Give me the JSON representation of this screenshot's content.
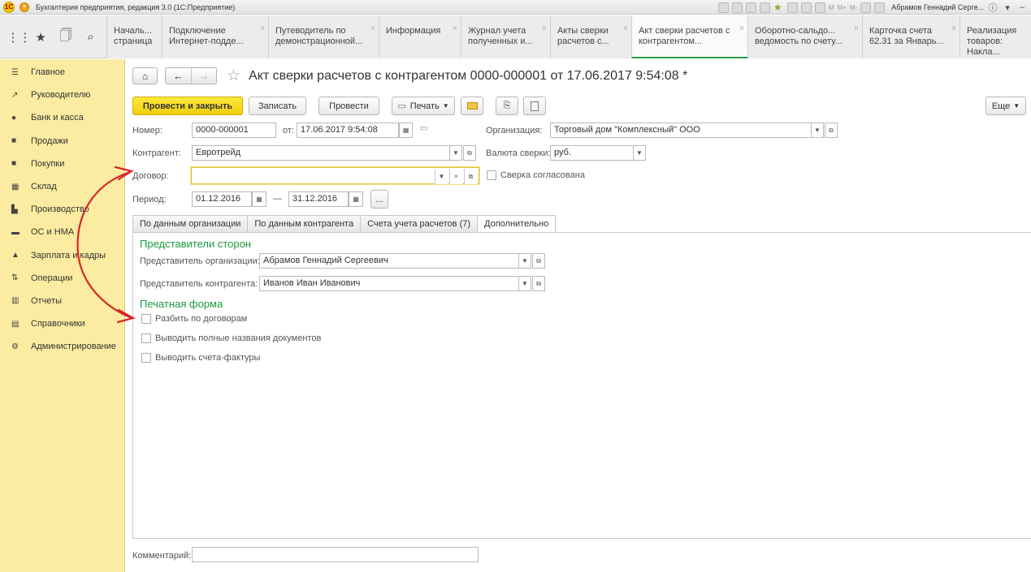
{
  "titlebar": {
    "title": "Бухгалтерия предприятия, редакция 3.0 (1С:Предприятие)",
    "m_labels": [
      "M",
      "M+",
      "M-"
    ],
    "user": "Абрамов Геннадий Серге..."
  },
  "tabs": [
    {
      "label": "Началь... страница"
    },
    {
      "label": "Подключение Интернет-подде..."
    },
    {
      "label": "Путеводитель по демонстрационной..."
    },
    {
      "label": "Информация"
    },
    {
      "label": "Журнал учета полученных и..."
    },
    {
      "label": "Акты сверки расчетов с..."
    },
    {
      "label": "Акт сверки расчетов с контрагентом..."
    },
    {
      "label": "Оборотно-сальдо... ведомость по счету..."
    },
    {
      "label": "Карточка счета 62.31 за Январь..."
    },
    {
      "label": "Реализация товаров: Накла..."
    }
  ],
  "sidebar": {
    "items": [
      {
        "label": "Главное",
        "icon": "menu-icon"
      },
      {
        "label": "Руководителю",
        "icon": "trend-icon"
      },
      {
        "label": "Банк и касса",
        "icon": "coins-icon"
      },
      {
        "label": "Продажи",
        "icon": "bag-icon"
      },
      {
        "label": "Покупки",
        "icon": "cart-icon"
      },
      {
        "label": "Склад",
        "icon": "warehouse-icon"
      },
      {
        "label": "Производство",
        "icon": "factory-icon"
      },
      {
        "label": "ОС и НМА",
        "icon": "truck-icon"
      },
      {
        "label": "Зарплата и кадры",
        "icon": "person-icon"
      },
      {
        "label": "Операции",
        "icon": "operations-icon"
      },
      {
        "label": "Отчеты",
        "icon": "report-icon"
      },
      {
        "label": "Справочники",
        "icon": "book-icon"
      },
      {
        "label": "Администрирование",
        "icon": "gear-icon"
      }
    ]
  },
  "document": {
    "title": "Акт сверки расчетов с контрагентом 0000-000001 от 17.06.2017 9:54:08 *"
  },
  "commands": {
    "post_close": "Провести и закрыть",
    "save": "Записать",
    "post": "Провести",
    "print": "Печать",
    "more": "Еще"
  },
  "form": {
    "number_label": "Номер:",
    "number_value": "0000-000001",
    "date_label": "от:",
    "date_value": "17.06.2017  9:54:08",
    "org_label": "Организация:",
    "org_value": "Торговый дом \"Комплексный\" ООО",
    "counterparty_label": "Контрагент:",
    "counterparty_value": "Евротрейд",
    "currency_label": "Валюта сверки:",
    "currency_value": "руб.",
    "contract_label": "Договор:",
    "contract_value": "",
    "agreed_label": "Сверка согласована",
    "period_label": "Период:",
    "period_from": "01.12.2016",
    "period_dash": "—",
    "period_to": "31.12.2016",
    "ellipsis": "..."
  },
  "form_tabs": [
    {
      "label": "По данным организации"
    },
    {
      "label": "По данным контрагента"
    },
    {
      "label": "Счета учета расчетов (7)"
    },
    {
      "label": "Дополнительно"
    }
  ],
  "additional": {
    "reps_section": "Представители сторон",
    "org_rep_label": "Представитель организации:",
    "org_rep_value": "Абрамов Геннадий Сергеевич",
    "cp_rep_label": "Представитель контрагента:",
    "cp_rep_value": "Иванов Иван Иванович",
    "print_section": "Печатная форма",
    "split_label": "Разбить по договорам",
    "full_names_label": "Выводить полные названия документов",
    "invoices_label": "Выводить счета-фактуры"
  },
  "comment": {
    "label": "Комментарий:",
    "value": ""
  },
  "colors": {
    "sidebar_bg": "#fbeca1",
    "primary_button": "#f1cd0e",
    "section_green": "#199a3d",
    "annotation_red": "#d8262a",
    "active_tab_underline": "#2e9a48"
  }
}
